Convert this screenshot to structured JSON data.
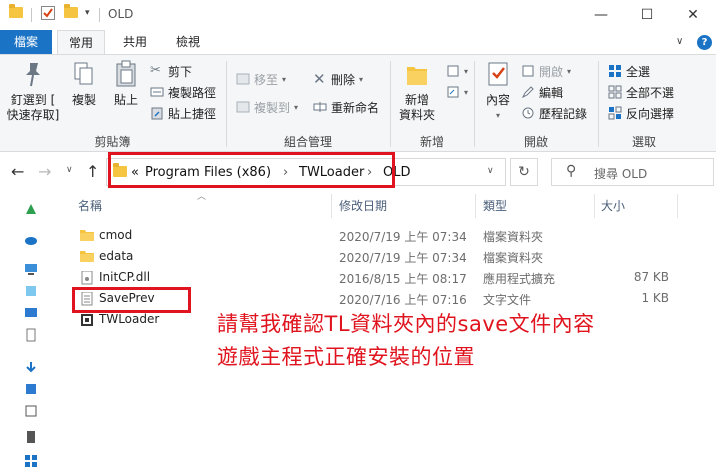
{
  "window": {
    "title": "OLD",
    "minimize_glyph": "—",
    "maximize_glyph": "☐",
    "close_glyph": "✕"
  },
  "ribbon_tabs": {
    "file": "檔案",
    "home": "常用",
    "share": "共用",
    "view": "檢視"
  },
  "ribbon": {
    "clipboard": {
      "label": "剪貼簿",
      "pin_line1": "釘選到 [",
      "pin_line2": "快速存取]",
      "copy": "複製",
      "paste": "貼上",
      "cut": "剪下",
      "copy_path": "複製路徑",
      "paste_shortcut": "貼上捷徑"
    },
    "organize": {
      "label": "組合管理",
      "move_to": "移至",
      "copy_to": "複製到",
      "delete": "刪除",
      "rename": "重新命名"
    },
    "new": {
      "label": "新增",
      "new_folder_line1": "新增",
      "new_folder_line2": "資料夾"
    },
    "open": {
      "label": "開啟",
      "properties": "內容",
      "open": "開啟",
      "edit": "編輯",
      "history": "歷程記錄"
    },
    "select": {
      "label": "選取",
      "select_all": "全選",
      "select_none": "全部不選",
      "invert": "反向選擇"
    }
  },
  "address": {
    "chevron": "«",
    "crumbs": [
      "Program Files (x86)",
      "TWLoader",
      "OLD"
    ],
    "separator": "›",
    "search_placeholder": "搜尋 OLD"
  },
  "columns": {
    "name": "名稱",
    "modified": "修改日期",
    "type": "類型",
    "size": "大小"
  },
  "files": [
    {
      "name": "cmod",
      "modified": "2020/7/19 上午 07:34",
      "type": "檔案資料夾",
      "size": "",
      "icon": "folder-icon"
    },
    {
      "name": "edata",
      "modified": "2020/7/19 上午 07:34",
      "type": "檔案資料夾",
      "size": "",
      "icon": "folder-icon"
    },
    {
      "name": "InitCP.dll",
      "modified": "2016/8/15 上午 08:17",
      "type": "應用程式擴充",
      "size": "87 KB",
      "icon": "dll-file-icon"
    },
    {
      "name": "SavePrev",
      "modified": "2020/7/16 上午 07:16",
      "type": "文字文件",
      "size": "1 KB",
      "icon": "text-file-icon"
    },
    {
      "name": "TWLoader",
      "modified": "",
      "type": "",
      "size": "",
      "icon": "exe-file-icon"
    }
  ],
  "annotation": {
    "line1": "請幫我確認TL資料夾內的save文件內容",
    "line2": "遊戲主程式正確安裝的位置",
    "color": "#e0141e"
  },
  "colors": {
    "accent": "#1a73c5",
    "folder": "#f5c542",
    "highlight_red": "#e0141e"
  }
}
